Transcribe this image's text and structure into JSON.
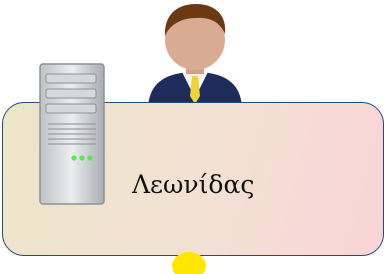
{
  "node": {
    "name": "Λεωνίδας",
    "icons": {
      "user": "user-avatar-icon",
      "machine": "server-tower-icon"
    }
  },
  "colors": {
    "card_border": "#1f4e79",
    "card_gradient_start": "#ece6c9",
    "card_gradient_end": "#f9d4d6",
    "status_leds": "#5ce65c",
    "indicator": "#ffe600"
  }
}
